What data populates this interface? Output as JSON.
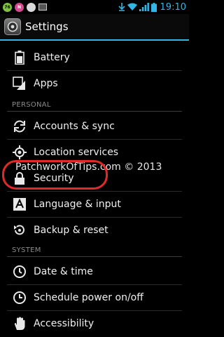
{
  "status_bar": {
    "time": "19:10",
    "icons": [
      "usb-debug-icon",
      "notification-icon",
      "sync-icon",
      "image-icon",
      "download-icon",
      "wifi-icon",
      "signal-icon",
      "battery-icon"
    ]
  },
  "action_bar": {
    "title": "Settings",
    "icon": "settings-app-icon"
  },
  "sections": {
    "personal": "PERSONAL",
    "system": "SYSTEM"
  },
  "items": {
    "battery": "Battery",
    "apps": "Apps",
    "accounts": "Accounts & sync",
    "location": "Location services",
    "security": "Security",
    "language": "Language & input",
    "backup": "Backup & reset",
    "datetime": "Date & time",
    "schedule": "Schedule power on/off",
    "accessibility": "Accessibility"
  },
  "watermark": "PatchworkOfTips.com © 2013",
  "colors": {
    "accent": "#33b5e5",
    "highlight": "#e02a2a"
  }
}
